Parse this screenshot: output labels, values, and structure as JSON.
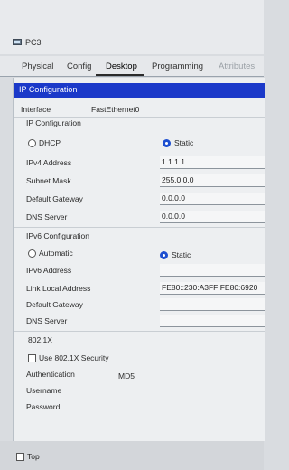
{
  "window": {
    "title": "PC3",
    "icon": "pc-icon"
  },
  "tabs": [
    {
      "label": "Physical",
      "active": false
    },
    {
      "label": "Config",
      "active": false
    },
    {
      "label": "Desktop",
      "active": true
    },
    {
      "label": "Programming",
      "active": false
    },
    {
      "label": "Attributes",
      "active": false
    }
  ],
  "ip_config": {
    "header": "IP Configuration",
    "interface_label": "Interface",
    "interface_value": "FastEthernet0",
    "ipv4_section": "IP Configuration",
    "dhcp_label": "DHCP",
    "static_label": "Static",
    "ipv4_mode": "Static",
    "ipv4_address_label": "IPv4 Address",
    "ipv4_address": "1.1.1.1",
    "subnet_mask_label": "Subnet Mask",
    "subnet_mask": "255.0.0.0",
    "default_gateway_label": "Default Gateway",
    "default_gateway": "0.0.0.0",
    "dns_server_label": "DNS Server",
    "dns_server": "0.0.0.0"
  },
  "ipv6_config": {
    "section": "IPv6 Configuration",
    "automatic_label": "Automatic",
    "static_label": "Static",
    "mode": "Static",
    "ipv6_address_label": "IPv6 Address",
    "ipv6_address": "",
    "link_local_label": "Link Local Address",
    "link_local": "FE80::230:A3FF:FE80:6920",
    "default_gateway_label": "Default Gateway",
    "default_gateway": "",
    "dns_server_label": "DNS Server",
    "dns_server": ""
  },
  "dot1x": {
    "section": "802.1X",
    "use_label": "Use 802.1X Security",
    "checked": false,
    "authentication_label": "Authentication",
    "authentication": "MD5",
    "username_label": "Username",
    "username": "",
    "password_label": "Password",
    "password": ""
  },
  "footer": {
    "top_label": "Top",
    "top_checked": false
  },
  "colors": {
    "header_bar": "#1b39c9",
    "radio_selected": "#1d4fd0",
    "panel_bg": "#edeff1"
  }
}
